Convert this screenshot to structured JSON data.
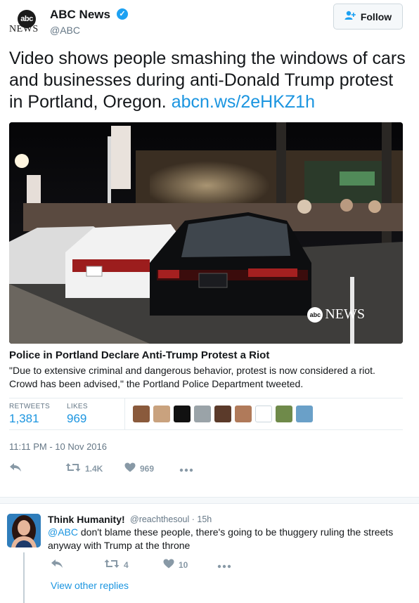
{
  "author": {
    "logo_text": "abc",
    "logo_word": "NEWS",
    "display_name": "ABC News",
    "verified_icon": "verified-badge-icon",
    "handle": "@ABC"
  },
  "follow": {
    "label": "Follow",
    "icon": "add-user-icon"
  },
  "tweet": {
    "text": "Video shows people smashing the windows of cars and businesses during anti-Donald Trump protest in Portland, Oregon.",
    "link": "abcn.ws/2eHKZ1h"
  },
  "card": {
    "watermark_logo": "abc",
    "watermark_text": "NEWS",
    "title": "Police in Portland Declare Anti-Trump Protest a Riot",
    "description": "\"Due to extensive criminal and dangerous behavior, protest is now considered a riot. Crowd has been advised,\" the Portland Police Department tweeted."
  },
  "stats": {
    "retweets_label": "RETWEETS",
    "retweets_value": "1,381",
    "likes_label": "LIKES",
    "likes_value": "969",
    "liker_colors": [
      "#8a5a3c",
      "#c9a27e",
      "#111111",
      "#9aa3a8",
      "#5b3a2a",
      "#b07a5a",
      "#ffffff",
      "#6f8a4a",
      "#6aa0c8"
    ]
  },
  "timestamp": "11:11 PM - 10 Nov 2016",
  "actions": {
    "reply_icon": "reply-icon",
    "retweet_icon": "retweet-icon",
    "retweet_count": "1.4K",
    "like_icon": "heart-icon",
    "like_count": "969",
    "more_icon": "more-icon"
  },
  "reply": {
    "name": "Think Humanity!",
    "handle_time": "@reachthesoul · 15h",
    "mention": "@ABC",
    "text": " don't blame these people, there's going to be thuggery ruling the streets anyway with Trump at the throne",
    "retweet_count": "4",
    "like_count": "10",
    "view_replies": "View other replies"
  },
  "colors": {
    "link": "#1b95e0",
    "verified": "#1da1f2",
    "muted": "#657786",
    "icon": "#8899a6"
  }
}
